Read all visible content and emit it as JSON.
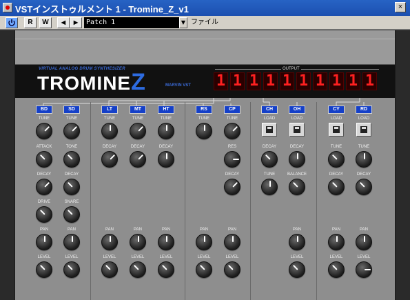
{
  "window": {
    "title": "VSTインストゥルメント 1 - Tromine_Z_v1",
    "close_label": "×"
  },
  "toolbar": {
    "power_icon": "power-icon",
    "r_label": "R",
    "w_label": "W",
    "prev_label": "◀",
    "next_label": "▶",
    "patch_value": "Patch   1",
    "file_label": "ファイル"
  },
  "brand": {
    "subtitle": "VIRTUAL ANALOG DRUM SYNTHESIZER",
    "logo": "TROMINE",
    "logo_z": "Z",
    "maker": "MARVIN VST",
    "output_label": "OUTPUT"
  },
  "leds": [
    "1",
    "1",
    "1",
    "1",
    "1",
    "1",
    "1",
    "1",
    "1",
    "1"
  ],
  "labels": {
    "tune": "TUNE",
    "attack": "ATTACK",
    "tone": "TONE",
    "decay": "DECAY",
    "drive": "DRIVE",
    "snare": "SNARE",
    "pan": "PAN",
    "level": "LEVEL",
    "res": "RES",
    "load": "LOAD",
    "balance": "BALANCE"
  },
  "channels": {
    "bd": "BD",
    "sd": "SD",
    "lt": "LT",
    "mt": "MT",
    "ht": "HT",
    "rs": "RS",
    "cp": "CP",
    "ch": "CH",
    "oh": "OH",
    "cy": "CY",
    "rd": "RD"
  },
  "colors": {
    "accent": "#1540c8",
    "led": "#ff2020"
  }
}
